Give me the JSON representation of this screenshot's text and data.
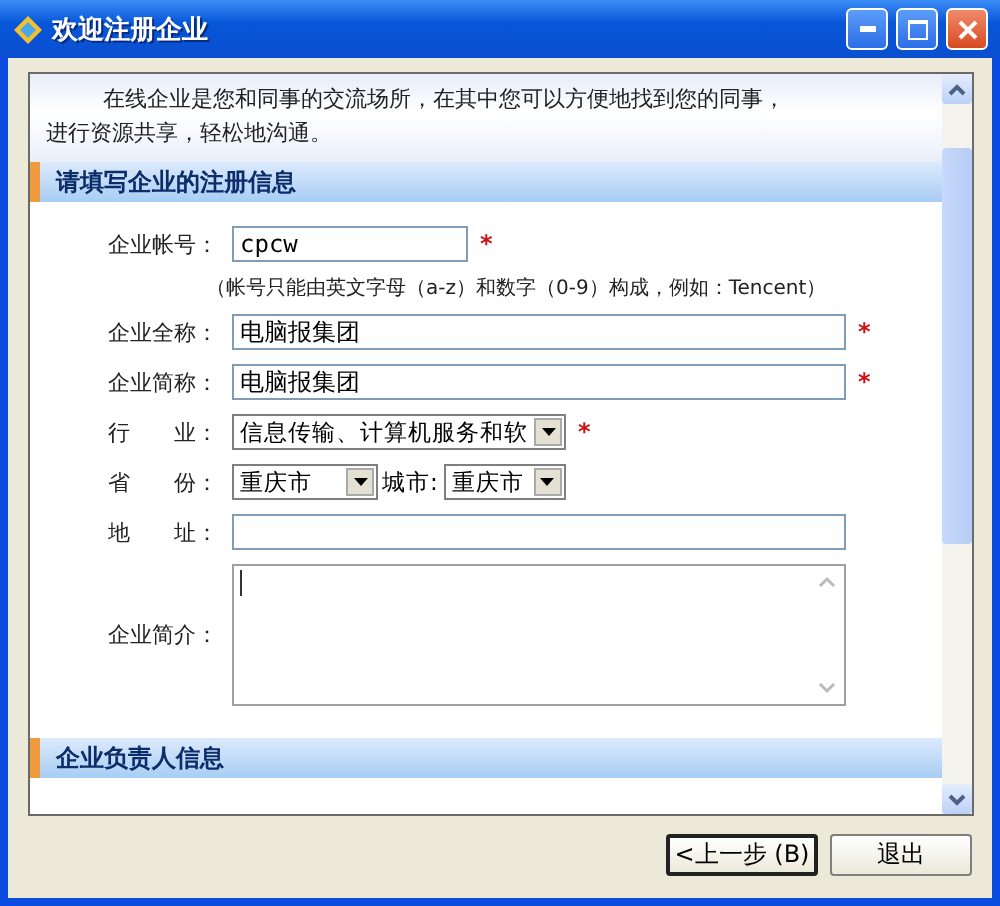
{
  "window": {
    "title": "欢迎注册企业"
  },
  "intro": [
    "在线企业是您和同事的交流场所，在其中您可以方便地找到您的同事，",
    "进行资源共享，轻松地沟通。"
  ],
  "sections": [
    {
      "title": "请填写企业的注册信息",
      "fields": [
        {
          "kind": "short_text",
          "label": "企业帐号：",
          "value": "cpcw",
          "mark": "*"
        },
        {
          "kind": "hint",
          "text": "（帐号只能由英文字母（a-z）和数字（0-9）构成，例如：Tencent）"
        },
        {
          "kind": "text",
          "label": "企业全称：",
          "value": "电脑报集团",
          "mark": "*"
        },
        {
          "kind": "text",
          "label": "企业简称：",
          "value": "电脑报集团",
          "mark": "*"
        },
        {
          "kind": "select",
          "label": "行　　业：",
          "value": "信息传输、计算机服务和软",
          "mark": "*"
        },
        {
          "kind": "select_pair",
          "label": "省　　份：",
          "value": "重庆市",
          "second_label": "城市:",
          "second_value": "重庆市"
        },
        {
          "kind": "text",
          "label": "地　　址："
        },
        {
          "kind": "textarea",
          "label": "企业简介："
        }
      ]
    },
    {
      "title": "企业负责人信息"
    }
  ],
  "buttons": [
    {
      "label": "<上一步 (B)",
      "default": true
    },
    {
      "label": "退出",
      "default": false
    }
  ]
}
